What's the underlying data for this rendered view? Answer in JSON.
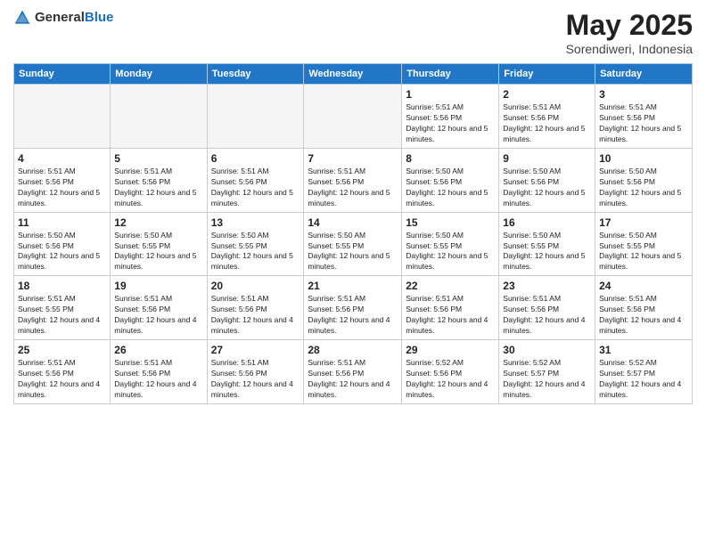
{
  "header": {
    "logo_general": "General",
    "logo_blue": "Blue",
    "title": "May 2025",
    "subtitle": "Sorendiweri, Indonesia"
  },
  "calendar": {
    "days_of_week": [
      "Sunday",
      "Monday",
      "Tuesday",
      "Wednesday",
      "Thursday",
      "Friday",
      "Saturday"
    ],
    "weeks": [
      [
        {
          "day": "",
          "sunrise": "",
          "sunset": "",
          "daylight": "",
          "empty": true
        },
        {
          "day": "",
          "sunrise": "",
          "sunset": "",
          "daylight": "",
          "empty": true
        },
        {
          "day": "",
          "sunrise": "",
          "sunset": "",
          "daylight": "",
          "empty": true
        },
        {
          "day": "",
          "sunrise": "",
          "sunset": "",
          "daylight": "",
          "empty": true
        },
        {
          "day": "1",
          "sunrise": "5:51 AM",
          "sunset": "5:56 PM",
          "daylight": "12 hours and 5 minutes."
        },
        {
          "day": "2",
          "sunrise": "5:51 AM",
          "sunset": "5:56 PM",
          "daylight": "12 hours and 5 minutes."
        },
        {
          "day": "3",
          "sunrise": "5:51 AM",
          "sunset": "5:56 PM",
          "daylight": "12 hours and 5 minutes."
        }
      ],
      [
        {
          "day": "4",
          "sunrise": "5:51 AM",
          "sunset": "5:56 PM",
          "daylight": "12 hours and 5 minutes."
        },
        {
          "day": "5",
          "sunrise": "5:51 AM",
          "sunset": "5:56 PM",
          "daylight": "12 hours and 5 minutes."
        },
        {
          "day": "6",
          "sunrise": "5:51 AM",
          "sunset": "5:56 PM",
          "daylight": "12 hours and 5 minutes."
        },
        {
          "day": "7",
          "sunrise": "5:51 AM",
          "sunset": "5:56 PM",
          "daylight": "12 hours and 5 minutes."
        },
        {
          "day": "8",
          "sunrise": "5:50 AM",
          "sunset": "5:56 PM",
          "daylight": "12 hours and 5 minutes."
        },
        {
          "day": "9",
          "sunrise": "5:50 AM",
          "sunset": "5:56 PM",
          "daylight": "12 hours and 5 minutes."
        },
        {
          "day": "10",
          "sunrise": "5:50 AM",
          "sunset": "5:56 PM",
          "daylight": "12 hours and 5 minutes."
        }
      ],
      [
        {
          "day": "11",
          "sunrise": "5:50 AM",
          "sunset": "5:56 PM",
          "daylight": "12 hours and 5 minutes."
        },
        {
          "day": "12",
          "sunrise": "5:50 AM",
          "sunset": "5:55 PM",
          "daylight": "12 hours and 5 minutes."
        },
        {
          "day": "13",
          "sunrise": "5:50 AM",
          "sunset": "5:55 PM",
          "daylight": "12 hours and 5 minutes."
        },
        {
          "day": "14",
          "sunrise": "5:50 AM",
          "sunset": "5:55 PM",
          "daylight": "12 hours and 5 minutes."
        },
        {
          "day": "15",
          "sunrise": "5:50 AM",
          "sunset": "5:55 PM",
          "daylight": "12 hours and 5 minutes."
        },
        {
          "day": "16",
          "sunrise": "5:50 AM",
          "sunset": "5:55 PM",
          "daylight": "12 hours and 5 minutes."
        },
        {
          "day": "17",
          "sunrise": "5:50 AM",
          "sunset": "5:55 PM",
          "daylight": "12 hours and 5 minutes."
        }
      ],
      [
        {
          "day": "18",
          "sunrise": "5:51 AM",
          "sunset": "5:55 PM",
          "daylight": "12 hours and 4 minutes."
        },
        {
          "day": "19",
          "sunrise": "5:51 AM",
          "sunset": "5:56 PM",
          "daylight": "12 hours and 4 minutes."
        },
        {
          "day": "20",
          "sunrise": "5:51 AM",
          "sunset": "5:56 PM",
          "daylight": "12 hours and 4 minutes."
        },
        {
          "day": "21",
          "sunrise": "5:51 AM",
          "sunset": "5:56 PM",
          "daylight": "12 hours and 4 minutes."
        },
        {
          "day": "22",
          "sunrise": "5:51 AM",
          "sunset": "5:56 PM",
          "daylight": "12 hours and 4 minutes."
        },
        {
          "day": "23",
          "sunrise": "5:51 AM",
          "sunset": "5:56 PM",
          "daylight": "12 hours and 4 minutes."
        },
        {
          "day": "24",
          "sunrise": "5:51 AM",
          "sunset": "5:56 PM",
          "daylight": "12 hours and 4 minutes."
        }
      ],
      [
        {
          "day": "25",
          "sunrise": "5:51 AM",
          "sunset": "5:56 PM",
          "daylight": "12 hours and 4 minutes."
        },
        {
          "day": "26",
          "sunrise": "5:51 AM",
          "sunset": "5:56 PM",
          "daylight": "12 hours and 4 minutes."
        },
        {
          "day": "27",
          "sunrise": "5:51 AM",
          "sunset": "5:56 PM",
          "daylight": "12 hours and 4 minutes."
        },
        {
          "day": "28",
          "sunrise": "5:51 AM",
          "sunset": "5:56 PM",
          "daylight": "12 hours and 4 minutes."
        },
        {
          "day": "29",
          "sunrise": "5:52 AM",
          "sunset": "5:56 PM",
          "daylight": "12 hours and 4 minutes."
        },
        {
          "day": "30",
          "sunrise": "5:52 AM",
          "sunset": "5:57 PM",
          "daylight": "12 hours and 4 minutes."
        },
        {
          "day": "31",
          "sunrise": "5:52 AM",
          "sunset": "5:57 PM",
          "daylight": "12 hours and 4 minutes."
        }
      ]
    ]
  }
}
